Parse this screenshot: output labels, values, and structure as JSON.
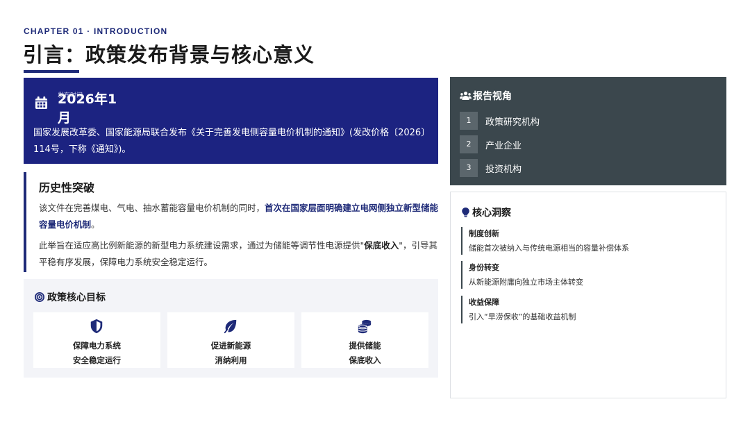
{
  "header": {
    "chapter": "CHAPTER 01 · INTRODUCTION",
    "title": "引言：政策发布背景与核心意义"
  },
  "banner": {
    "date_caption": "发布时间",
    "date": "2026年1月",
    "description": "国家发展改革委、国家能源局联合发布《关于完善发电侧容量电价机制的通知》(发改价格〔2026〕114号，下称《通知》)。"
  },
  "historic": {
    "title": "历史性突破",
    "p1_a": "该文件在完善煤电、气电、抽水蓄能容量电价机制的同时，",
    "p1_highlight": "首次在国家层面明确建立电网侧独立新型储能容量电价机制",
    "p1_end": "。",
    "p2_a": "此举旨在适应高比例新能源的新型电力系统建设需求，通过为储能等调节性电源提供\"",
    "p2_bold": "保底收入",
    "p2_b": "\"，引导其平稳有序发展，保障电力系统安全稳定运行。"
  },
  "goals": {
    "title": "政策核心目标",
    "items": [
      {
        "icon": "shield-icon",
        "line1": "保障电力系统",
        "line2": "安全稳定运行"
      },
      {
        "icon": "leaf-icon",
        "line1": "促进新能源",
        "line2": "消纳利用"
      },
      {
        "icon": "coins-icon",
        "line1": "提供储能",
        "line2": "保底收入"
      }
    ]
  },
  "perspective": {
    "title": "报告视角",
    "items": [
      {
        "num": "1",
        "label": "政策研究机构"
      },
      {
        "num": "2",
        "label": "产业企业"
      },
      {
        "num": "3",
        "label": "投资机构"
      }
    ]
  },
  "insights": {
    "title": "核心洞察",
    "items": [
      {
        "heading": "制度创新",
        "desc": "储能首次被纳入与传统电源相当的容量补偿体系"
      },
      {
        "heading": "身份转变",
        "desc": "从新能源附庸向独立市场主体转变"
      },
      {
        "heading": "收益保障",
        "desc": "引入“旱涝保收”的基础收益机制"
      }
    ]
  },
  "colors": {
    "accent": "#1e2a78",
    "banner": "#1c2381",
    "panel_dark": "#3b474d"
  }
}
